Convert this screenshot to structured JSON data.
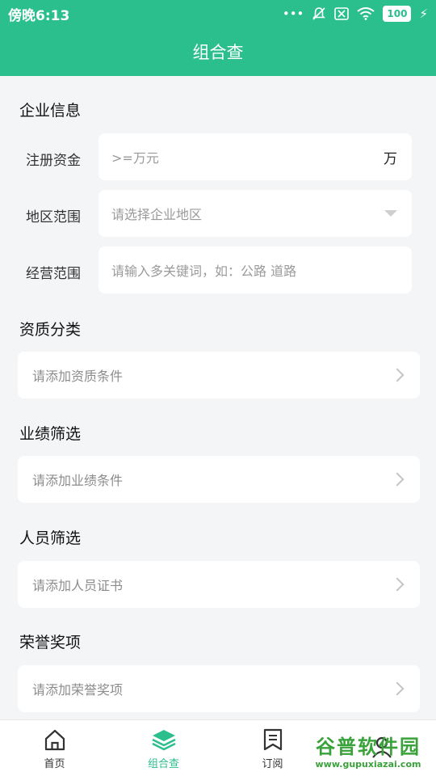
{
  "status_bar": {
    "time": "傍晚6:13",
    "battery": "100"
  },
  "header": {
    "title": "组合查"
  },
  "company": {
    "title": "企业信息",
    "capital_label": "注册资金",
    "capital_placeholder": ">=万元",
    "capital_unit": "万",
    "region_label": "地区范围",
    "region_placeholder": "请选择企业地区",
    "scope_label": "经营范围",
    "scope_placeholder": "请输入多关键词，如：公路 道路"
  },
  "qualification": {
    "title": "资质分类",
    "placeholder": "请添加资质条件"
  },
  "performance": {
    "title": "业绩筛选",
    "placeholder": "请添加业绩条件"
  },
  "personnel": {
    "title": "人员筛选",
    "placeholder": "请添加人员证书"
  },
  "honor": {
    "title": "荣誉奖项",
    "placeholder": "请添加荣誉奖项"
  },
  "tabbar": {
    "items": [
      {
        "label": "首页",
        "icon": "home-icon"
      },
      {
        "label": "组合查",
        "icon": "layers-icon"
      },
      {
        "label": "订阅",
        "icon": "bookmark-icon"
      },
      {
        "label": "",
        "icon": "user-icon"
      }
    ]
  },
  "watermark": {
    "main": "谷普软件园",
    "url": "www.gupuxiazai.com"
  },
  "colors": {
    "primary": "#2cbf8e",
    "background": "#f4f5f7"
  }
}
